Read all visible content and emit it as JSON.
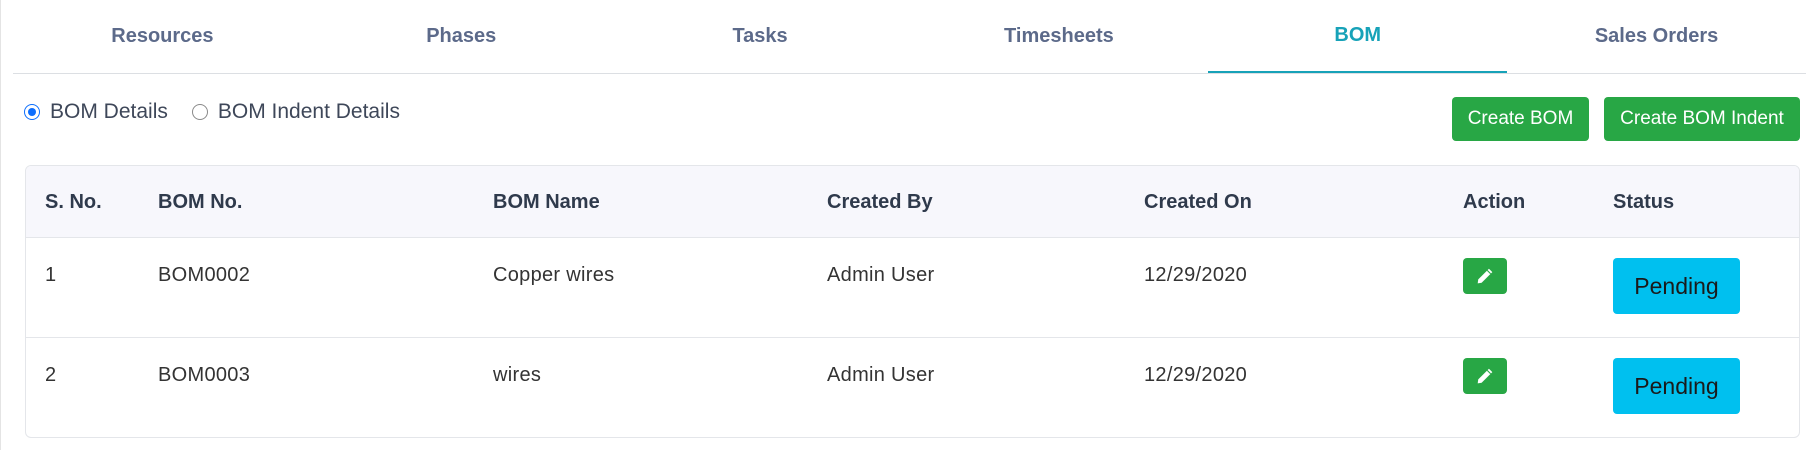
{
  "tabs": [
    {
      "label": "Resources",
      "active": false
    },
    {
      "label": "Phases",
      "active": false
    },
    {
      "label": "Tasks",
      "active": false
    },
    {
      "label": "Timesheets",
      "active": false
    },
    {
      "label": "BOM",
      "active": true
    },
    {
      "label": "Sales Orders",
      "active": false
    }
  ],
  "radios": {
    "bom_details": {
      "label": "BOM Details",
      "checked": true
    },
    "bom_indent_details": {
      "label": "BOM Indent Details",
      "checked": false
    }
  },
  "buttons": {
    "create_bom": "Create BOM",
    "create_bom_indent": "Create BOM Indent"
  },
  "table": {
    "headers": [
      "S. No.",
      "BOM No.",
      "BOM Name",
      "Created By",
      "Created On",
      "Action",
      "Status"
    ],
    "rows": [
      {
        "sno": "1",
        "bom_no": "BOM0002",
        "bom_name": "Copper wires",
        "created_by": "Admin User",
        "created_on": "12/29/2020",
        "status": "Pending"
      },
      {
        "sno": "2",
        "bom_no": "BOM0003",
        "bom_name": "wires",
        "created_by": "Admin User",
        "created_on": "12/29/2020",
        "status": "Pending"
      }
    ]
  },
  "colors": {
    "accent": "#17a2b8",
    "tab_text": "#5c6a8a",
    "button_green": "#28a745",
    "status_cyan": "#00c0ef",
    "radio_blue": "#0d6efd"
  },
  "icons": {
    "edit": "pencil-icon"
  }
}
